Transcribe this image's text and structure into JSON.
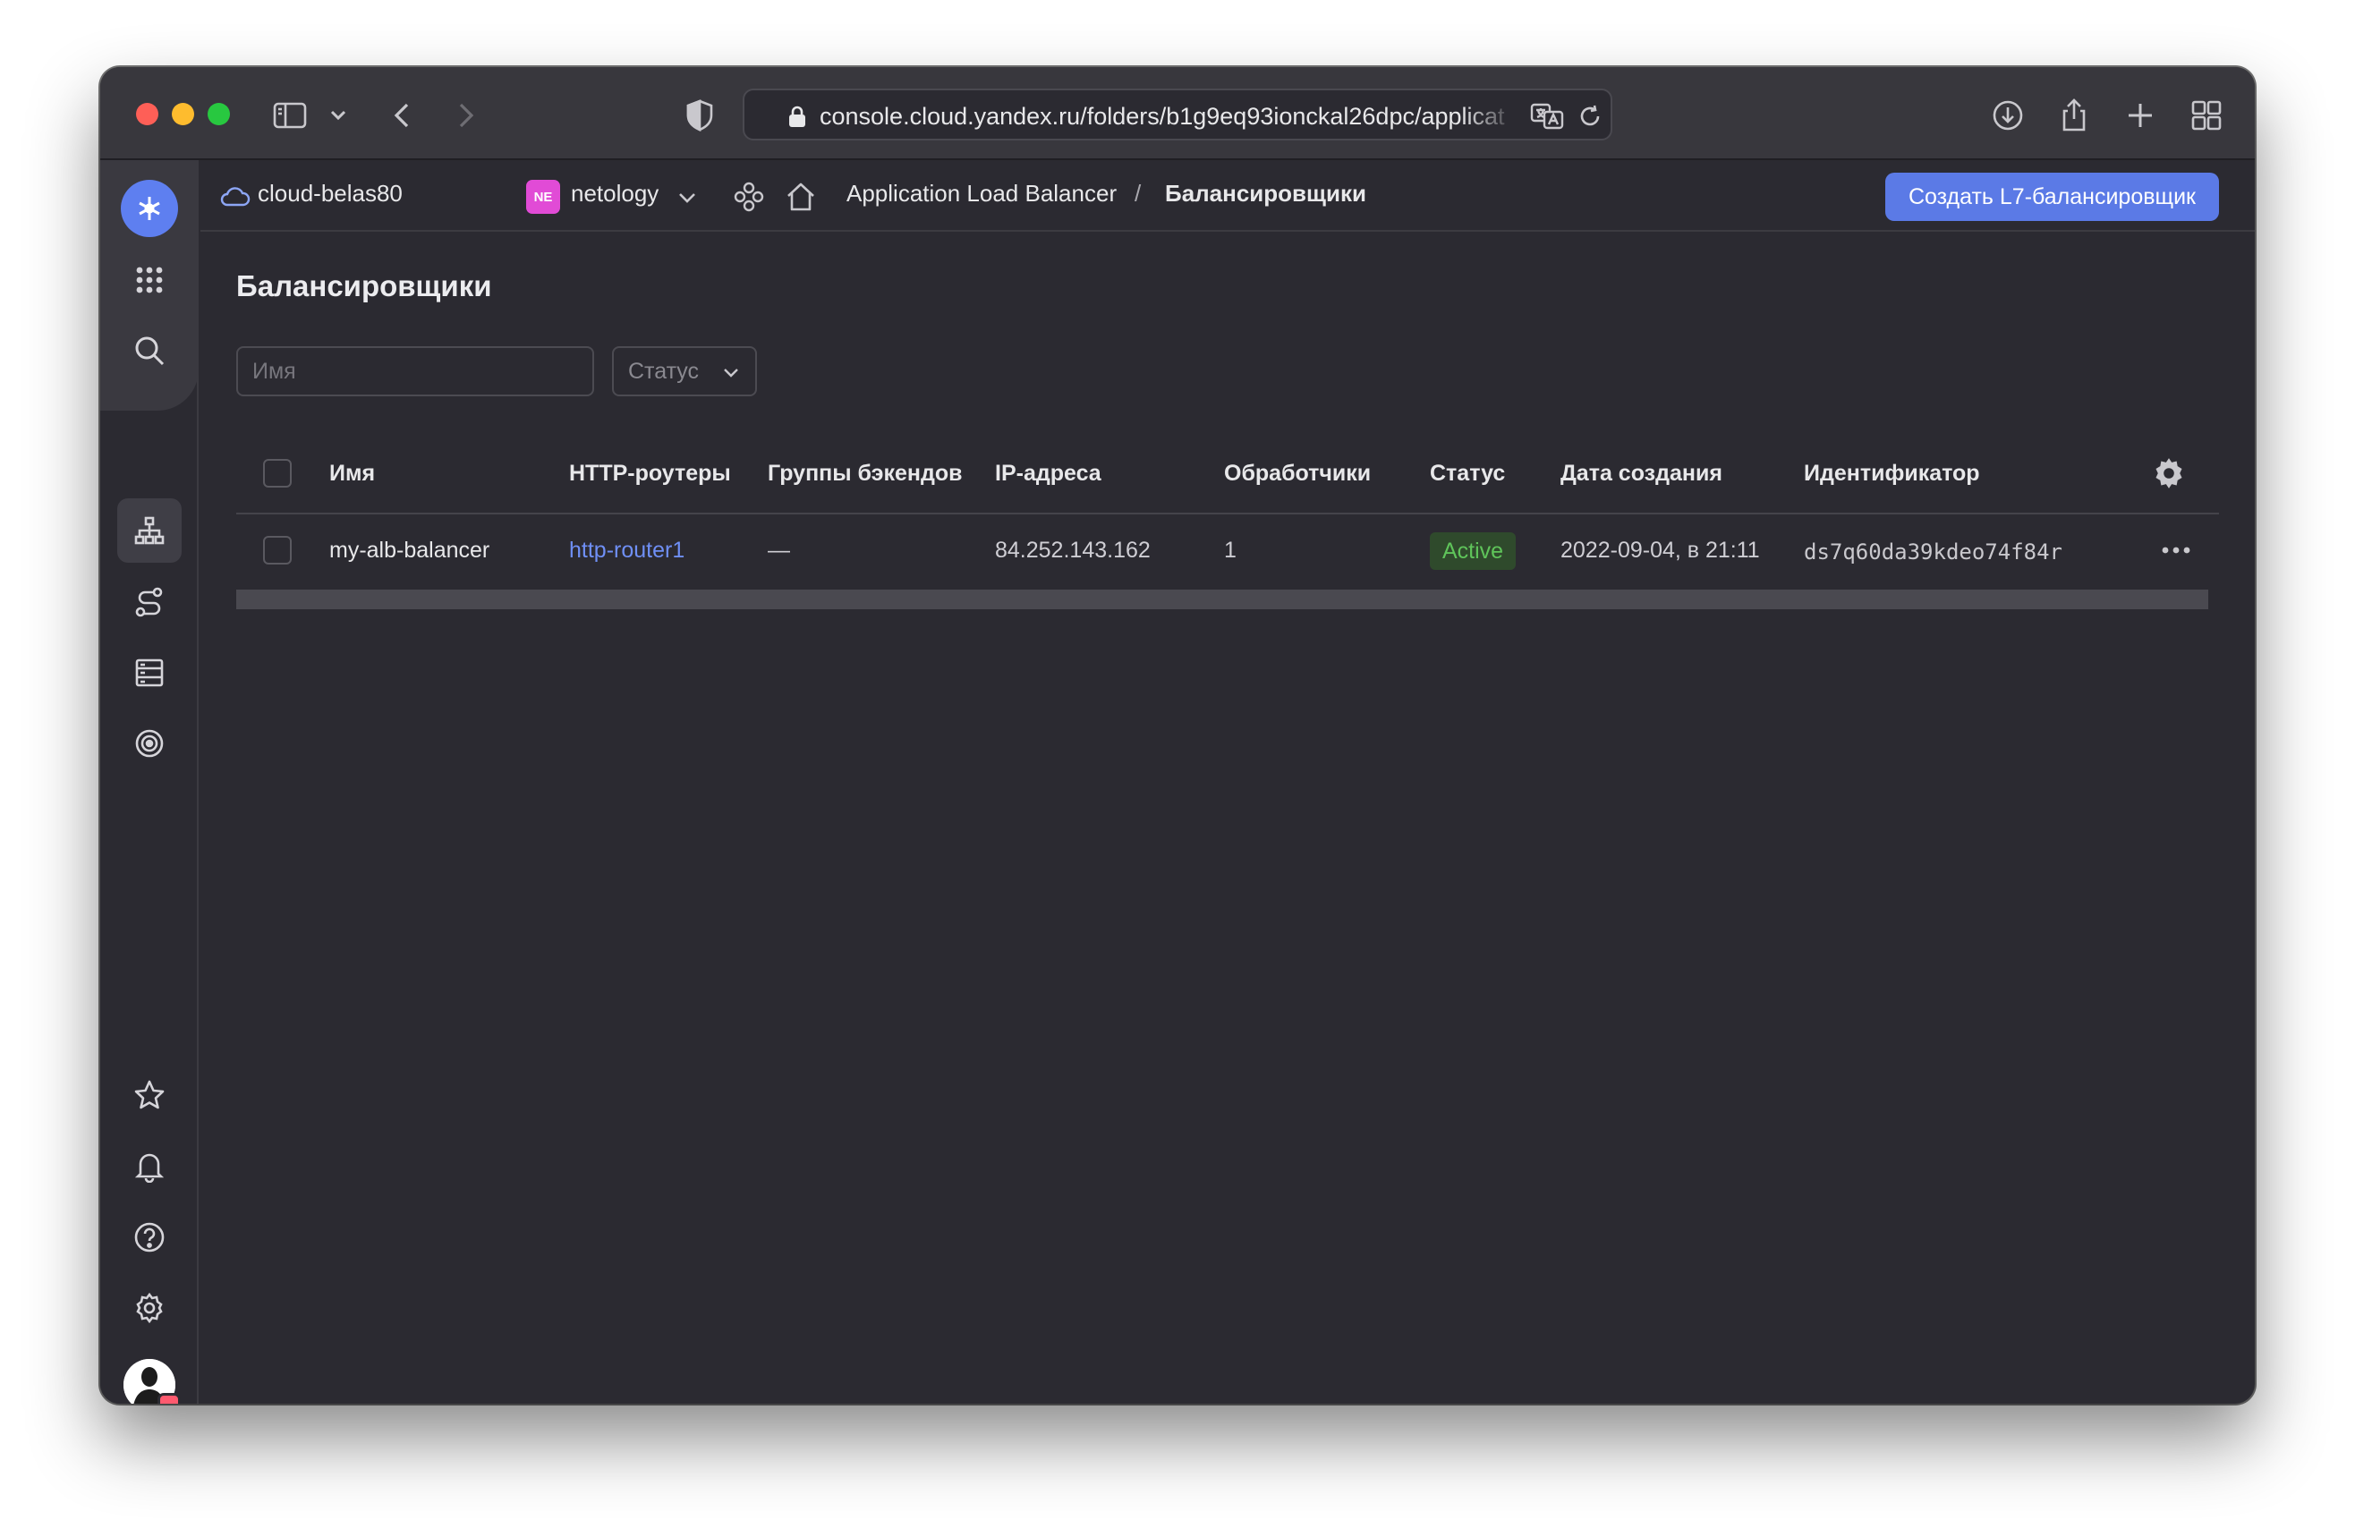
{
  "browser": {
    "url": "console.cloud.yandex.ru/folders/b1g9eq93ionckal26dpc/applicat"
  },
  "appbar": {
    "cloud_name": "cloud-belas80",
    "folder_badge": "NE",
    "folder_name": "netology",
    "breadcrumb_service": "Application Load Balancer",
    "breadcrumb_separator": "/",
    "breadcrumb_current": "Балансировщики",
    "create_button": "Создать L7-балансировщик"
  },
  "main": {
    "title": "Балансировщики",
    "filter_name_placeholder": "Имя",
    "filter_status_label": "Статус"
  },
  "table": {
    "columns": [
      "Имя",
      "HTTP-роутеры",
      "Группы бэкендов",
      "IP-адреса",
      "Обработчики",
      "Статус",
      "Дата создания",
      "Идентификатор"
    ],
    "rows": [
      {
        "name": "my-alb-balancer",
        "http_routers": "http-router1",
        "backend_groups": "—",
        "ip": "84.252.143.162",
        "listeners": "1",
        "status": "Active",
        "created": "2022-09-04, в 21:11",
        "id": "ds7q60da39kdeo74f84r"
      }
    ]
  },
  "colors": {
    "accent": "#5b7ae6",
    "status_active_bg": "#2f4a2c",
    "status_active_text": "#5fc45a",
    "link": "#6f8ff5"
  }
}
